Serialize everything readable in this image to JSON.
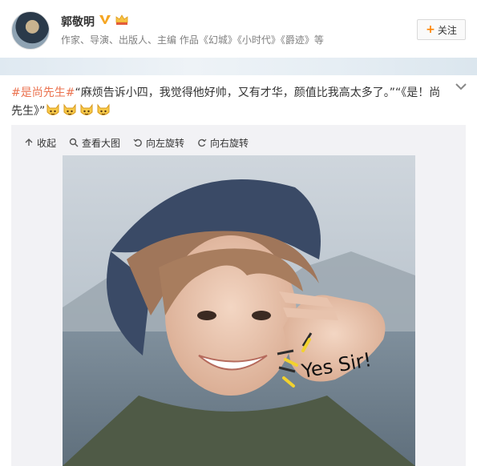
{
  "profile": {
    "name": "郭敬明",
    "bio": "作家、导演、出版人、主编 作品《幻城》《小时代》《爵迹》等",
    "follow_label": "关注",
    "verified_color": "#f5a623"
  },
  "post": {
    "tag": "#是尚先生#",
    "text": "“麻烦告诉小四，我觉得他好帅，又有才华，颜值比我高太多了。”“《是！尚先生》”",
    "emoji_count": 4,
    "emoji_icon": "cat-face-emoji",
    "tag_color": "#eb7350"
  },
  "toolbar": {
    "collapse": "收起",
    "view_large": "查看大图",
    "rotate_left": "向左旋转",
    "rotate_right": "向右旋转"
  },
  "photo": {
    "caption": "Yes Sir!"
  }
}
